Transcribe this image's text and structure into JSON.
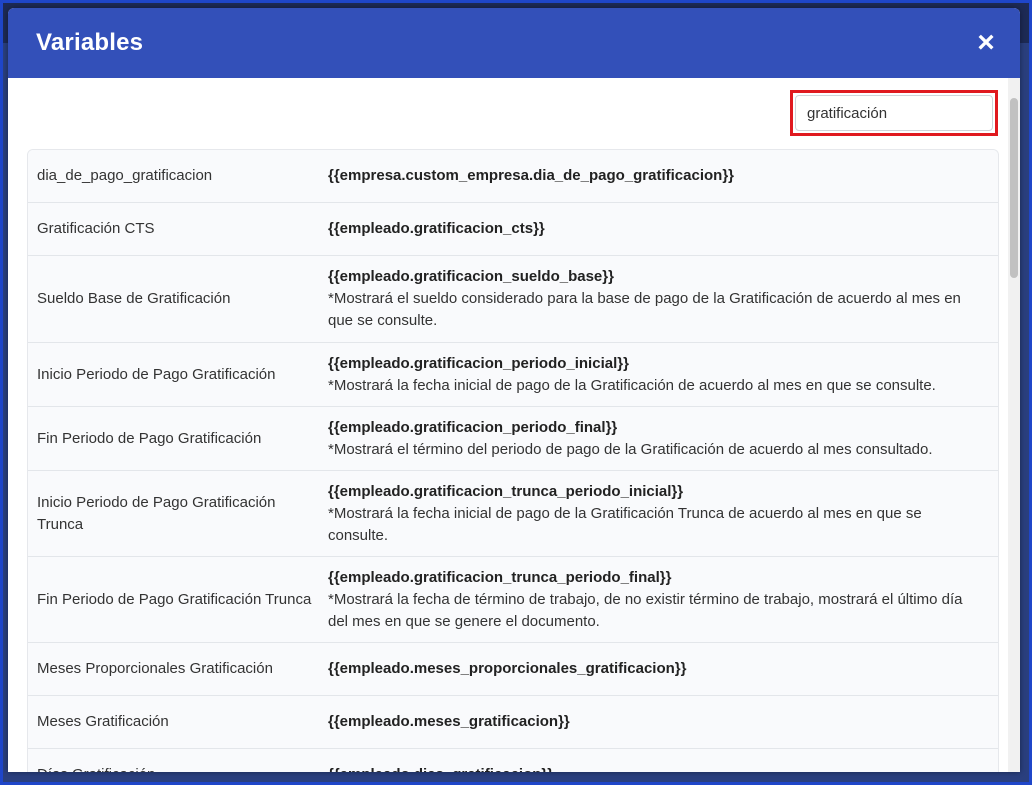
{
  "modal": {
    "title": "Variables",
    "close_icon": "×"
  },
  "search": {
    "value": "gratificación",
    "placeholder": ""
  },
  "rows": [
    {
      "name": "dia_de_pago_gratificacion",
      "code": "{{empresa.custom_empresa.dia_de_pago_gratificacion}}",
      "desc": ""
    },
    {
      "name": "Gratificación CTS",
      "code": "{{empleado.gratificacion_cts}}",
      "desc": ""
    },
    {
      "name": "Sueldo Base de Gratificación",
      "code": "{{empleado.gratificacion_sueldo_base}}",
      "desc": "*Mostrará el sueldo considerado para la base de pago de la Gratificación de acuerdo al mes en que se consulte."
    },
    {
      "name": "Inicio Periodo de Pago Gratificación",
      "code": "{{empleado.gratificacion_periodo_inicial}}",
      "desc": "*Mostrará la fecha inicial de pago de la Gratificación de acuerdo al mes en que se consulte."
    },
    {
      "name": "Fin Periodo de Pago Gratificación",
      "code": "{{empleado.gratificacion_periodo_final}}",
      "desc": "*Mostrará el término del periodo de pago de la Gratificación de acuerdo al mes consultado."
    },
    {
      "name": "Inicio Periodo de Pago Gratificación Trunca",
      "code": "{{empleado.gratificacion_trunca_periodo_inicial}}",
      "desc": "*Mostrará la fecha inicial de pago de la Gratificación Trunca de acuerdo al mes en que se consulte."
    },
    {
      "name": "Fin Periodo de Pago Gratificación Trunca",
      "code": "{{empleado.gratificacion_trunca_periodo_final}}",
      "desc": "*Mostrará la fecha de término de trabajo, de no existir término de trabajo, mostrará el último día del mes en que se genere el documento."
    },
    {
      "name": "Meses Proporcionales Gratificación",
      "code": "{{empleado.meses_proporcionales_gratificacion}}",
      "desc": ""
    },
    {
      "name": "Meses Gratificación",
      "code": "{{empleado.meses_gratificacion}}",
      "desc": ""
    },
    {
      "name": "Días Gratificación",
      "code": "{{empleado.dias_gratificacion}}",
      "desc": ""
    }
  ],
  "colors": {
    "header_bg": "#3350b9",
    "search_highlight": "#e0191f",
    "row_bg": "#f9fafc"
  }
}
